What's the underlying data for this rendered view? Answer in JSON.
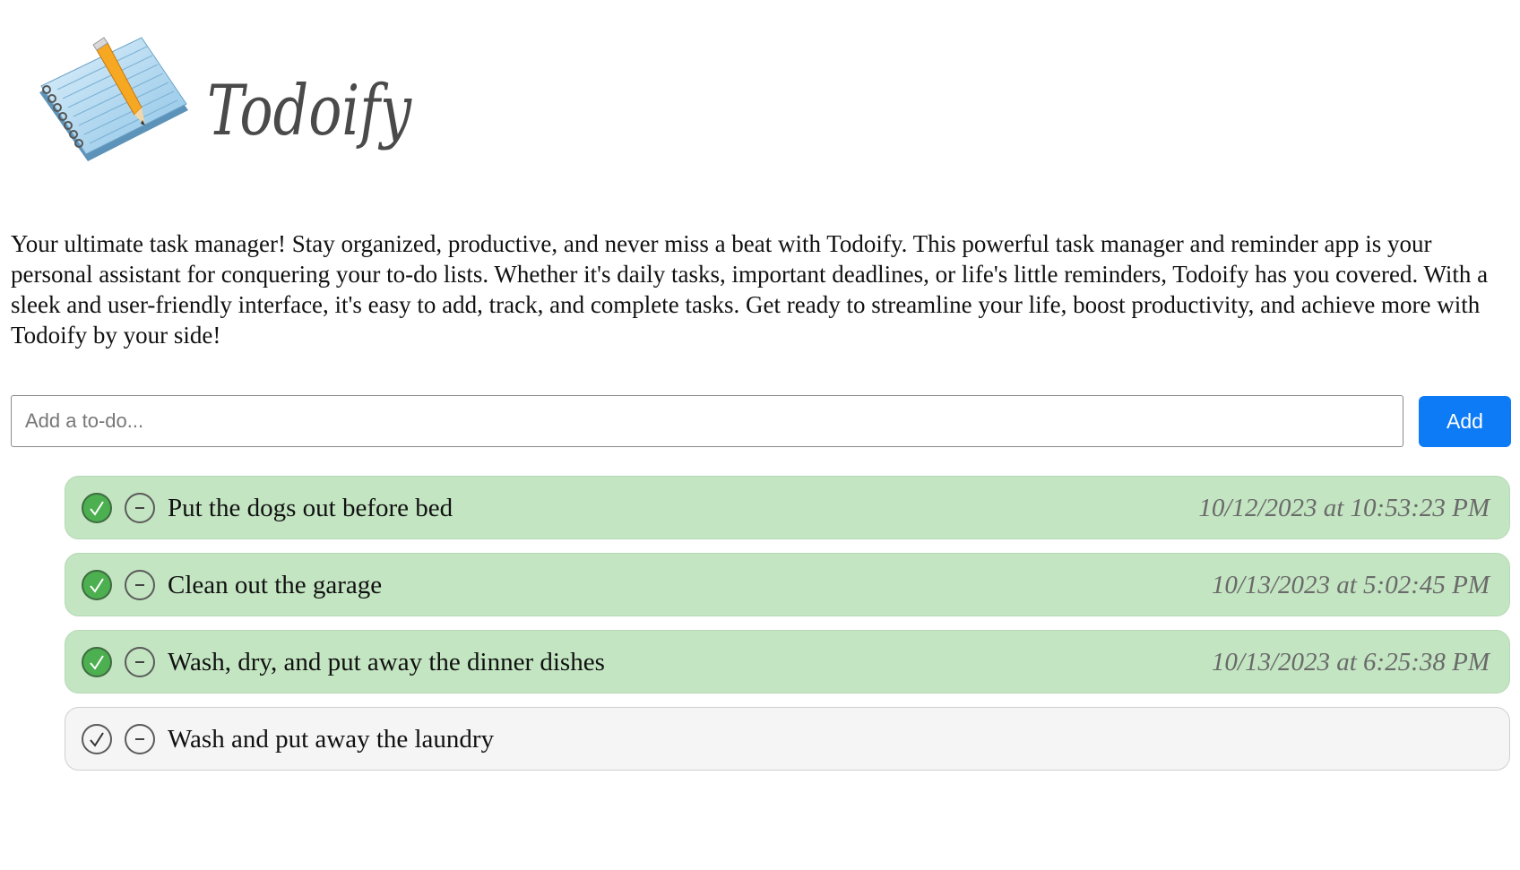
{
  "brand": {
    "logo_text": "Todoify",
    "logo_icon": "notepad-pencil-icon"
  },
  "intro": {
    "text": "Your ultimate task manager! Stay organized, productive, and never miss a beat with Todoify. This powerful task manager and reminder app is your personal assistant for conquering your to-do lists. Whether it's daily tasks, important deadlines, or life's little reminders, Todoify has you covered. With a sleek and user-friendly interface, it's easy to add, track, and complete tasks. Get ready to streamline your life, boost productivity, and achieve more with Todoify by your side!"
  },
  "add_form": {
    "input_value": "",
    "placeholder": "Add a to-do...",
    "button_label": "Add"
  },
  "todos": [
    {
      "text": "Put the dogs out before bed",
      "completed": true,
      "completed_at": "10/12/2023 at 10:53:23 PM"
    },
    {
      "text": "Clean out the garage",
      "completed": true,
      "completed_at": "10/13/2023 at 5:02:45 PM"
    },
    {
      "text": "Wash, dry, and put away the dinner dishes",
      "completed": true,
      "completed_at": "10/13/2023 at 6:25:38 PM"
    },
    {
      "text": "Wash and put away the laundry",
      "completed": false,
      "completed_at": ""
    }
  ],
  "icons": {
    "check": "check-circle-icon",
    "remove": "minus-circle-icon"
  },
  "colors": {
    "accent": "#0d7bf5",
    "done_background": "#c3e5c2",
    "pending_background": "#f5f5f5",
    "check_fill": "#4caf50"
  }
}
